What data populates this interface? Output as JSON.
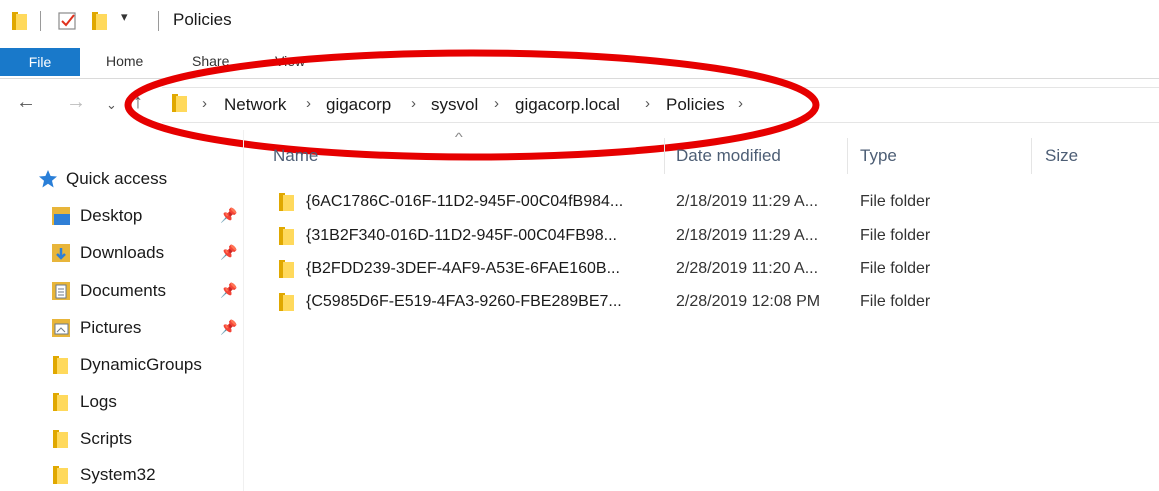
{
  "window": {
    "title": "Policies"
  },
  "ribbon": {
    "tabs": [
      "File",
      "Home",
      "Share",
      "View"
    ]
  },
  "address": {
    "crumbs": [
      "Network",
      "gigacorp",
      "sysvol",
      "gigacorp.local",
      "Policies"
    ]
  },
  "columns": {
    "name": "Name",
    "date": "Date modified",
    "type": "Type",
    "size": "Size"
  },
  "files": [
    {
      "name": "{6AC1786C-016F-11D2-945F-00C04fB984...",
      "date": "2/18/2019 11:29 A...",
      "type": "File folder"
    },
    {
      "name": "{31B2F340-016D-11D2-945F-00C04FB98...",
      "date": "2/18/2019 11:29 A...",
      "type": "File folder"
    },
    {
      "name": "{B2FDD239-3DEF-4AF9-A53E-6FAE160B...",
      "date": "2/28/2019 11:20 A...",
      "type": "File folder"
    },
    {
      "name": "{C5985D6F-E519-4FA3-9260-FBE289BE7...",
      "date": "2/28/2019 12:08 PM",
      "type": "File folder"
    }
  ],
  "sidebar": {
    "quick_access": "Quick access",
    "items": [
      "Desktop",
      "Downloads",
      "Documents",
      "Pictures",
      "DynamicGroups",
      "Logs",
      "Scripts",
      "System32"
    ]
  },
  "icons": [
    "folder-icon",
    "checkmark-icon",
    "dropdown-icon",
    "pin-icon",
    "star-icon",
    "back-arrow-icon",
    "forward-arrow-icon",
    "up-arrow-icon",
    "chevron-right-icon"
  ],
  "colors": {
    "file_tab": "#1979ca",
    "folder": "#ffd95c",
    "annotation": "#e60000",
    "quick_access_star": "#2a7fd8"
  }
}
